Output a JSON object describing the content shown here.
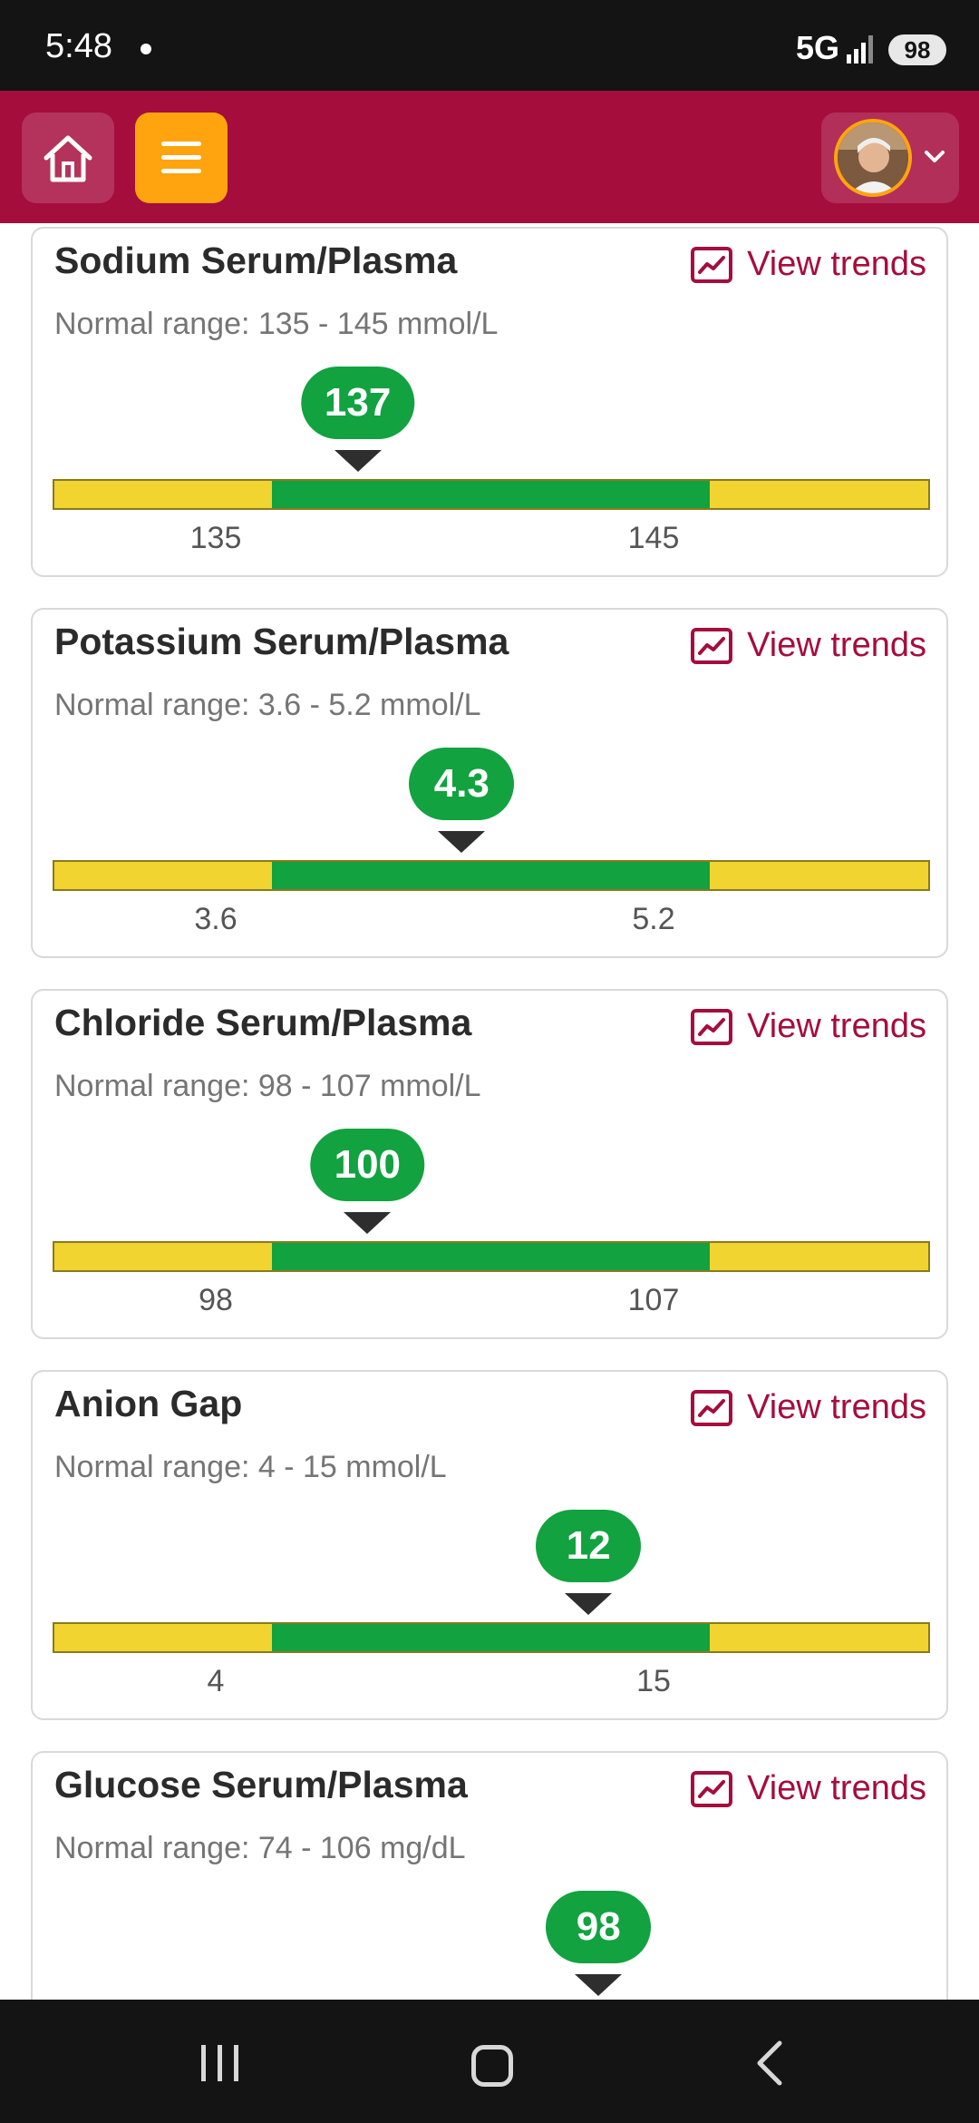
{
  "status_bar": {
    "time": "5:48",
    "network": "5G",
    "battery": "98"
  },
  "header": {
    "home_icon": "home-icon",
    "menu_icon": "hamburger-menu-icon",
    "profile_icon": "avatar",
    "accent": "#a50d3d",
    "menu_color": "#ffa40e"
  },
  "trend_label": "View trends",
  "colors": {
    "normal": "#12a240",
    "out_of_range": "#f2d431"
  },
  "results": [
    {
      "title": "Sodium Serum/Plasma",
      "range": "Normal range: 135 - 145 mmol/L",
      "value": "137",
      "low": "135",
      "high": "145",
      "numeric": 137,
      "min": 135,
      "max": 145
    },
    {
      "title": "Potassium Serum/Plasma",
      "range": "Normal range: 3.6 - 5.2 mmol/L",
      "value": "4.3",
      "low": "3.6",
      "high": "5.2",
      "numeric": 4.3,
      "min": 3.6,
      "max": 5.2
    },
    {
      "title": "Chloride Serum/Plasma",
      "range": "Normal range: 98 - 107 mmol/L",
      "value": "100",
      "low": "98",
      "high": "107",
      "numeric": 100,
      "min": 98,
      "max": 107
    },
    {
      "title": "Anion Gap",
      "range": "Normal range: 4 - 15 mmol/L",
      "value": "12",
      "low": "4",
      "high": "15",
      "numeric": 12,
      "min": 4,
      "max": 15
    },
    {
      "title": "Glucose Serum/Plasma",
      "range": "Normal range: 74 - 106 mg/dL",
      "value": "98",
      "low": "74",
      "high": "106",
      "numeric": 98,
      "min": 74,
      "max": 106
    }
  ]
}
